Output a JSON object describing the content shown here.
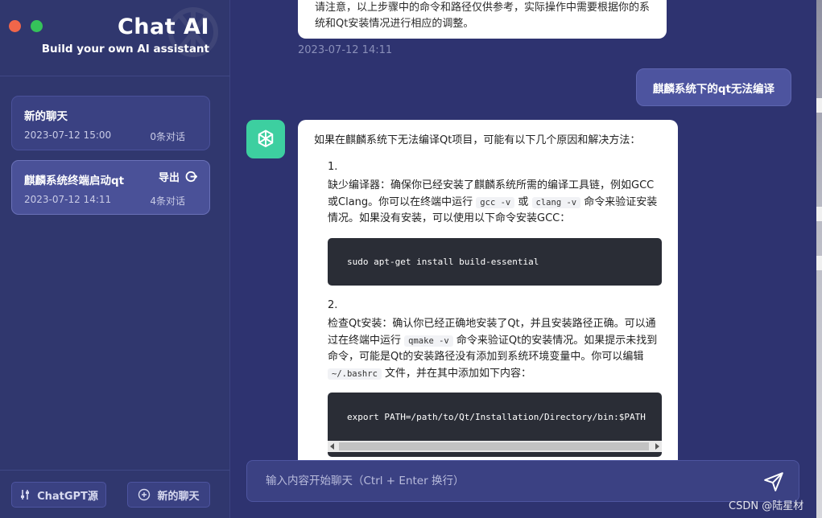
{
  "brand": {
    "title": "Chat AI",
    "subtitle": "Build your own AI assistant"
  },
  "conversations": [
    {
      "title": "新的聊天",
      "date": "2023-07-12 15:00",
      "count": "0条对话"
    },
    {
      "title": "麒麟系统终端启动qt",
      "date": "2023-07-12 14:11",
      "count": "4条对话",
      "export_label": "导出"
    }
  ],
  "sidebar_buttons": {
    "source": "ChatGPT源",
    "new_chat": "新的聊天"
  },
  "chat": {
    "prev_message": "请注意，以上步骤中的命令和路径仅供参考，实际操作中需要根据你的系统和Qt安装情况进行相应的调整。",
    "prev_time": "2023-07-12 14:11",
    "user_message": "麒麟系统下的qt无法编译",
    "answer": {
      "intro": "如果在麒麟系统下无法编译Qt项目，可能有以下几个原因和解决方法：",
      "item1_num": "1.",
      "item1_a": "缺少编译器：确保你已经安装了麒麟系统所需的编译工具链，例如GCC或Clang。你可以在终端中运行",
      "item1_code1": "gcc -v",
      "item1_b": "或",
      "item1_code2": "clang -v",
      "item1_c": "命令来验证安装情况。如果没有安装，可以使用以下命令安装GCC：",
      "code1": "sudo apt-get install build-essential",
      "item2_num": "2.",
      "item2_a": "检查Qt安装：确认你已经正确地安装了Qt，并且安装路径正确。可以通过在终端中运行",
      "item2_code1": "qmake -v",
      "item2_b": "命令来验证Qt的安装情况。如果提示未找到命令，可能是Qt的安装路径没有添加到系统环境变量中。你可以编辑",
      "item2_code2": "~/.bashrc",
      "item2_c": "文件，并在其中添加如下内容：",
      "code2": "export PATH=/path/to/Qt/Installation/Directory/bin:$PATH"
    }
  },
  "input": {
    "placeholder": "输入内容开始聊天（Ctrl + Enter 换行）"
  },
  "watermark": "CSDN @陆星材",
  "colors": {
    "accent": "#3dcfa0",
    "background": "#2e3370"
  }
}
